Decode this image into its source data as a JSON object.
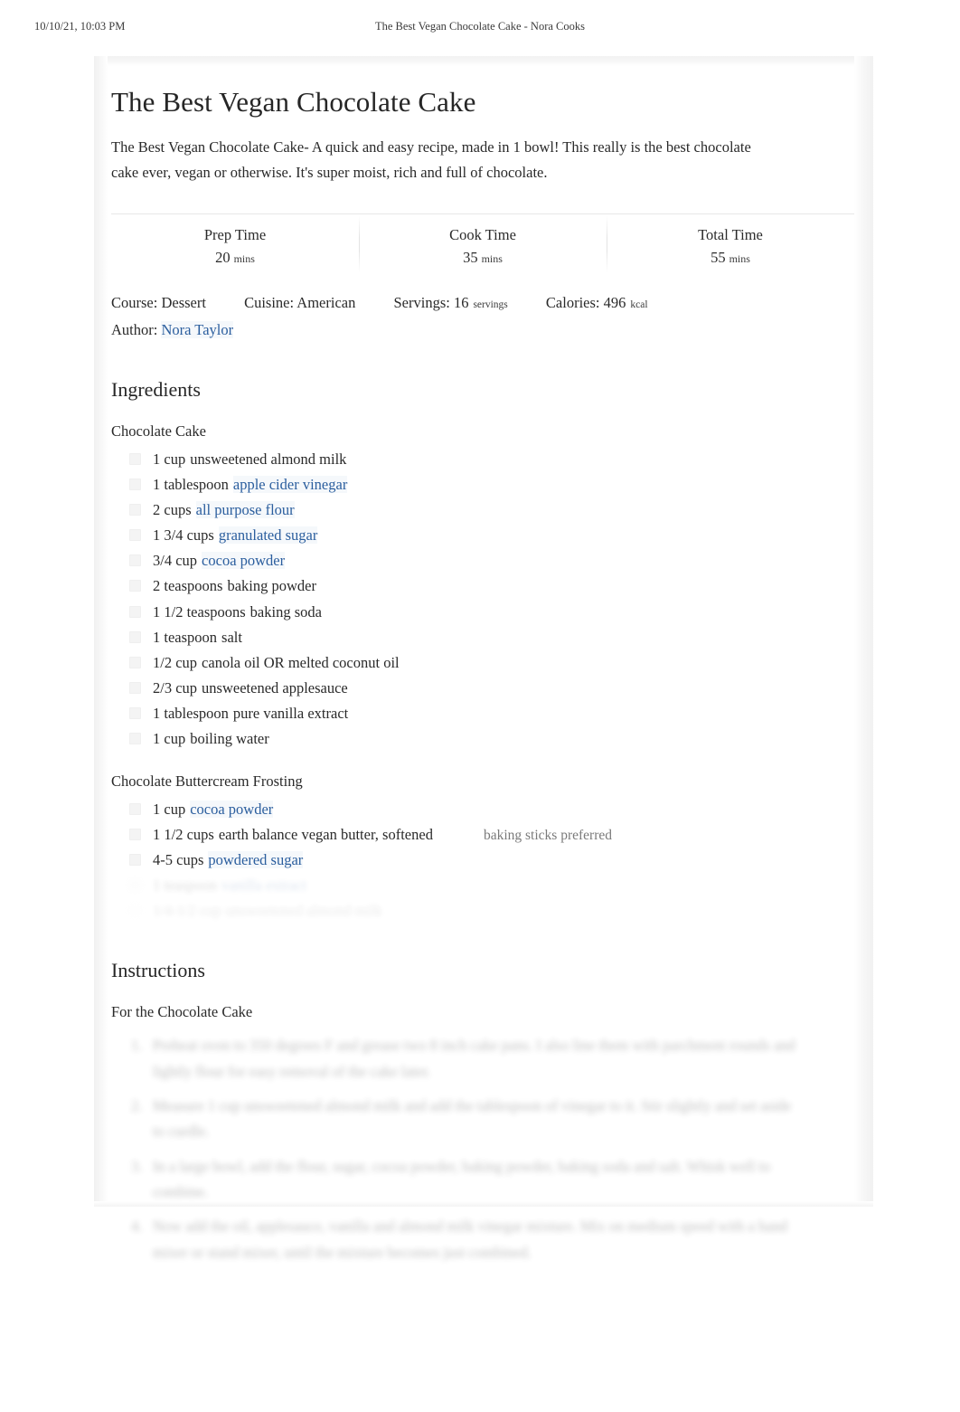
{
  "print_header": {
    "timestamp": "10/10/21, 10:03 PM",
    "page_title": "The Best Vegan Chocolate Cake - Nora Cooks"
  },
  "recipe": {
    "title": "The Best Vegan Chocolate Cake",
    "description": "The Best Vegan Chocolate Cake- A quick and easy recipe, made in 1 bowl! This really is the best chocolate cake ever, vegan or otherwise. It's super moist, rich and full of chocolate.",
    "times": [
      {
        "label": "Prep Time",
        "value": "20",
        "unit": "mins"
      },
      {
        "label": "Cook Time",
        "value": "35",
        "unit": "mins"
      },
      {
        "label": "Total Time",
        "value": "55",
        "unit": "mins"
      }
    ],
    "meta": {
      "course": "Course: Dessert",
      "cuisine": "Cuisine: American",
      "servings_label": "Servings: 16",
      "servings_unit": "servings",
      "calories_label": "Calories: 496",
      "calories_unit": "kcal",
      "author_label": "Author:",
      "author_name": "Nora Taylor"
    },
    "ingredients": {
      "heading": "Ingredients",
      "groups": [
        {
          "name": "Chocolate Cake",
          "items": [
            {
              "amount": "1 cup",
              "name": "unsweetened almond milk",
              "link": false,
              "note": ""
            },
            {
              "amount": "1 tablespoon",
              "name": "apple cider vinegar",
              "link": true,
              "note": ""
            },
            {
              "amount": "2 cups",
              "name": "all purpose flour",
              "link": true,
              "note": ""
            },
            {
              "amount": "1 3/4 cups",
              "name": "granulated sugar",
              "link": true,
              "note": ""
            },
            {
              "amount": "3/4 cup",
              "name": "cocoa powder",
              "link": true,
              "note": ""
            },
            {
              "amount": "2 teaspoons",
              "name": "baking powder",
              "link": false,
              "note": ""
            },
            {
              "amount": "1 1/2 teaspoons",
              "name": "baking soda",
              "link": false,
              "note": ""
            },
            {
              "amount": "1 teaspoon",
              "name": "salt",
              "link": false,
              "note": ""
            },
            {
              "amount": "1/2 cup",
              "name": "canola oil OR melted coconut oil",
              "link": false,
              "note": ""
            },
            {
              "amount": "2/3 cup",
              "name": "unsweetened applesauce",
              "link": false,
              "note": ""
            },
            {
              "amount": "1 tablespoon",
              "name": "pure vanilla extract",
              "link": false,
              "note": ""
            },
            {
              "amount": "1 cup",
              "name": "boiling water",
              "link": false,
              "note": ""
            }
          ]
        },
        {
          "name": "Chocolate Buttercream Frosting",
          "items": [
            {
              "amount": "1 cup",
              "name": "cocoa powder",
              "link": true,
              "note": ""
            },
            {
              "amount": "1 1/2 cups",
              "name": "earth balance vegan butter, softened",
              "link": false,
              "note": "baking sticks preferred"
            },
            {
              "amount": "4-5 cups",
              "name": "powdered sugar",
              "link": true,
              "note": ""
            }
          ]
        }
      ]
    },
    "instructions": {
      "heading": "Instructions",
      "group_name": "For the Chocolate Cake",
      "steps": [
        "Preheat oven to 350 degrees F and grease two 8 inch cake pans. I also line them with parchment rounds and lightly flour for easy removal of the cake later.",
        "Measure 1 cup unsweetened almond milk and add the tablespoon of vinegar to it. Stir slightly and set aside to curdle.",
        "In a large bowl, add the flour, sugar, cocoa powder, baking powder, baking soda and salt. Whisk well to combine.",
        "Now add the oil, applesauce, vanilla and almond milk vinegar mixture. Mix on medium speed with a hand mixer or stand mixer, until the mixture becomes just combined."
      ]
    }
  },
  "colors": {
    "link": "#2b5e9e",
    "text": "#2a2a2a",
    "note": "#7a7a7a",
    "card_border": "#ececec"
  }
}
